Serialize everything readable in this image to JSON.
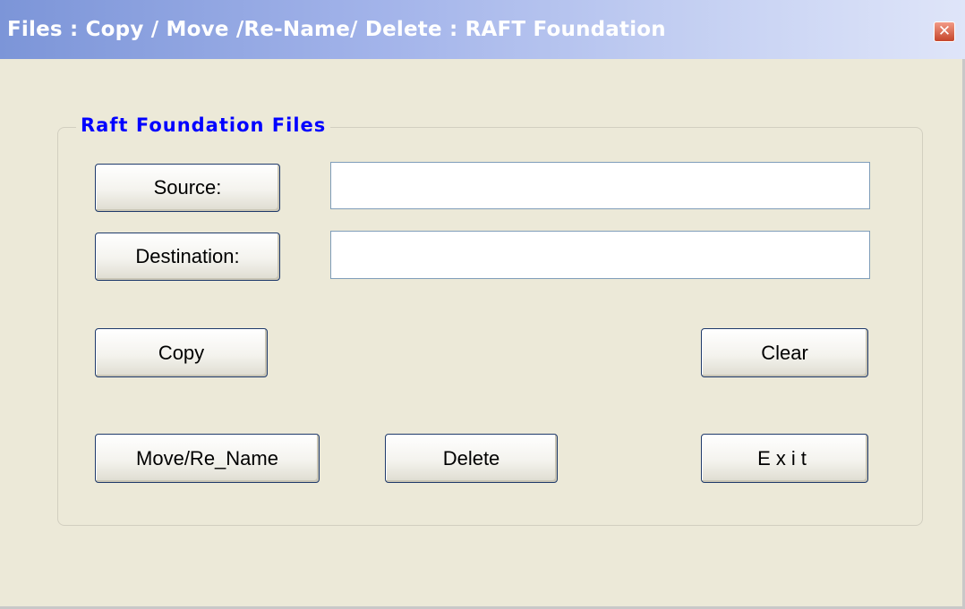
{
  "window": {
    "title": "Files : Copy / Move /Re-Name/ Delete : RAFT Foundation",
    "close_glyph": "✕"
  },
  "group": {
    "title": "Raft Foundation Files"
  },
  "buttons": {
    "source": "Source:",
    "destination": "Destination:",
    "copy": "Copy",
    "clear": "Clear",
    "move_rename": "Move/Re_Name",
    "delete": "Delete",
    "exit": "Exit"
  },
  "fields": {
    "source_value": "",
    "destination_value": ""
  },
  "colors": {
    "titlebar_start": "#7c95d8",
    "titlebar_end": "#dfe5f9",
    "group_title": "#0000ff",
    "window_bg": "#ece9d8"
  },
  "icons": {
    "close": "close-icon"
  }
}
